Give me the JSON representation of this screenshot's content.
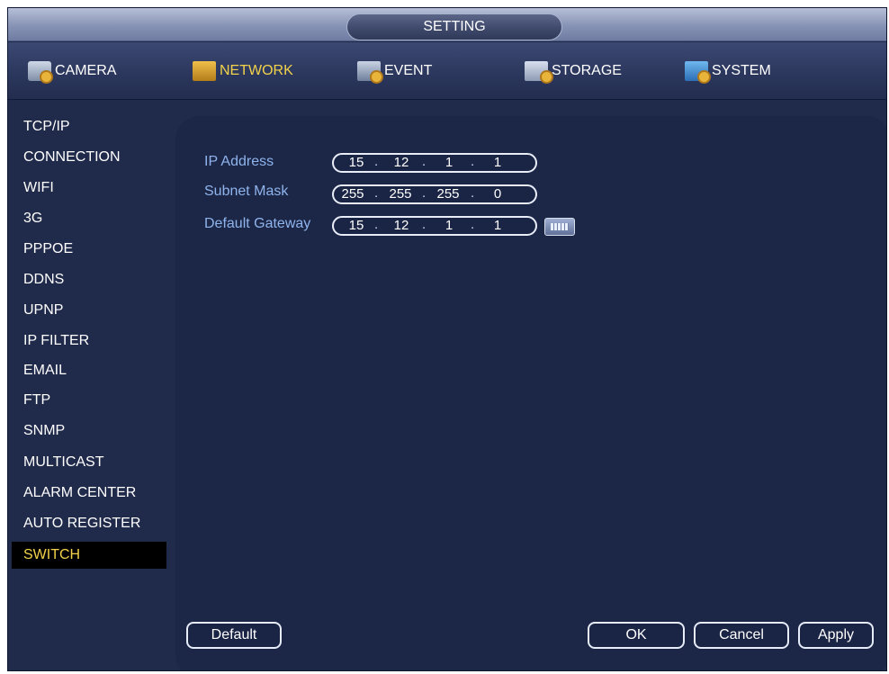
{
  "window": {
    "title": "SETTING"
  },
  "tabs": [
    {
      "label": "CAMERA",
      "icon": "camera-settings-icon",
      "active": false
    },
    {
      "label": "NETWORK",
      "icon": "network-icon",
      "active": true
    },
    {
      "label": "EVENT",
      "icon": "event-icon",
      "active": false
    },
    {
      "label": "STORAGE",
      "icon": "storage-icon",
      "active": false
    },
    {
      "label": "SYSTEM",
      "icon": "system-icon",
      "active": false
    }
  ],
  "sidebar": {
    "items": [
      {
        "label": "TCP/IP"
      },
      {
        "label": "CONNECTION"
      },
      {
        "label": "WIFI"
      },
      {
        "label": "3G"
      },
      {
        "label": "PPPOE"
      },
      {
        "label": "DDNS"
      },
      {
        "label": "UPNP"
      },
      {
        "label": "IP FILTER"
      },
      {
        "label": "EMAIL"
      },
      {
        "label": "FTP"
      },
      {
        "label": "SNMP"
      },
      {
        "label": "MULTICAST"
      },
      {
        "label": "ALARM CENTER"
      },
      {
        "label": "AUTO REGISTER"
      },
      {
        "label": "SWITCH"
      }
    ],
    "active_label": "SWITCH"
  },
  "form": {
    "ip_address": {
      "label": "IP Address",
      "octets": [
        "15",
        "12",
        "1",
        "1"
      ]
    },
    "subnet_mask": {
      "label": "Subnet Mask",
      "octets": [
        "255",
        "255",
        "255",
        "0"
      ]
    },
    "default_gateway": {
      "label": "Default Gateway",
      "octets": [
        "15",
        "12",
        "1",
        "1"
      ]
    }
  },
  "buttons": {
    "default": "Default",
    "ok": "OK",
    "cancel": "Cancel",
    "apply": "Apply"
  },
  "colors": {
    "active_text": "#f2d24a",
    "field_label": "#8fb4ec",
    "panel_bg": "#1c2747",
    "window_bg": "#202a4a"
  }
}
